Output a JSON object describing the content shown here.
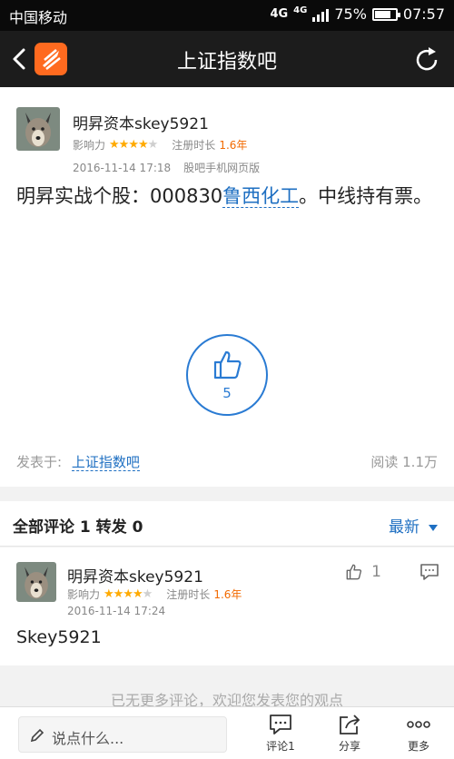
{
  "status": {
    "carrier": "中国移动",
    "network1": "4G",
    "network2": "4G",
    "battery": "75%",
    "battery_level": 0.75,
    "time": "07:57"
  },
  "nav": {
    "title": "上证指数吧"
  },
  "post": {
    "author": "明昇资本skey5921",
    "influence_label": "影响力",
    "influence_stars": 4,
    "reg_label": "注册时长",
    "reg_value": "1.6年",
    "time": "2016-11-14 17:18",
    "source": "股吧手机网页版",
    "body_prefix": "明昇实战个股：000830",
    "stock_name": "鲁西化工",
    "body_suffix": "。中线持有票。",
    "likes": "5",
    "posted_in_label": "发表于:",
    "posted_in": "上证指数吧",
    "reads": "阅读 1.1万"
  },
  "comments_head": {
    "title": "全部评论 1 转发 0",
    "sort": "最新"
  },
  "comment": {
    "author": "明昇资本skey5921",
    "influence_label": "影响力",
    "influence_stars": 4,
    "reg_label": "注册时长",
    "reg_value": "1.6年",
    "time": "2016-11-14 17:24",
    "likes": "1",
    "text": "Skey5921"
  },
  "no_more": "已无更多评论，欢迎您发表您的观点",
  "bottom": {
    "placeholder": "说点什么...",
    "comment_label": "评论1",
    "share_label": "分享",
    "more_label": "更多"
  }
}
